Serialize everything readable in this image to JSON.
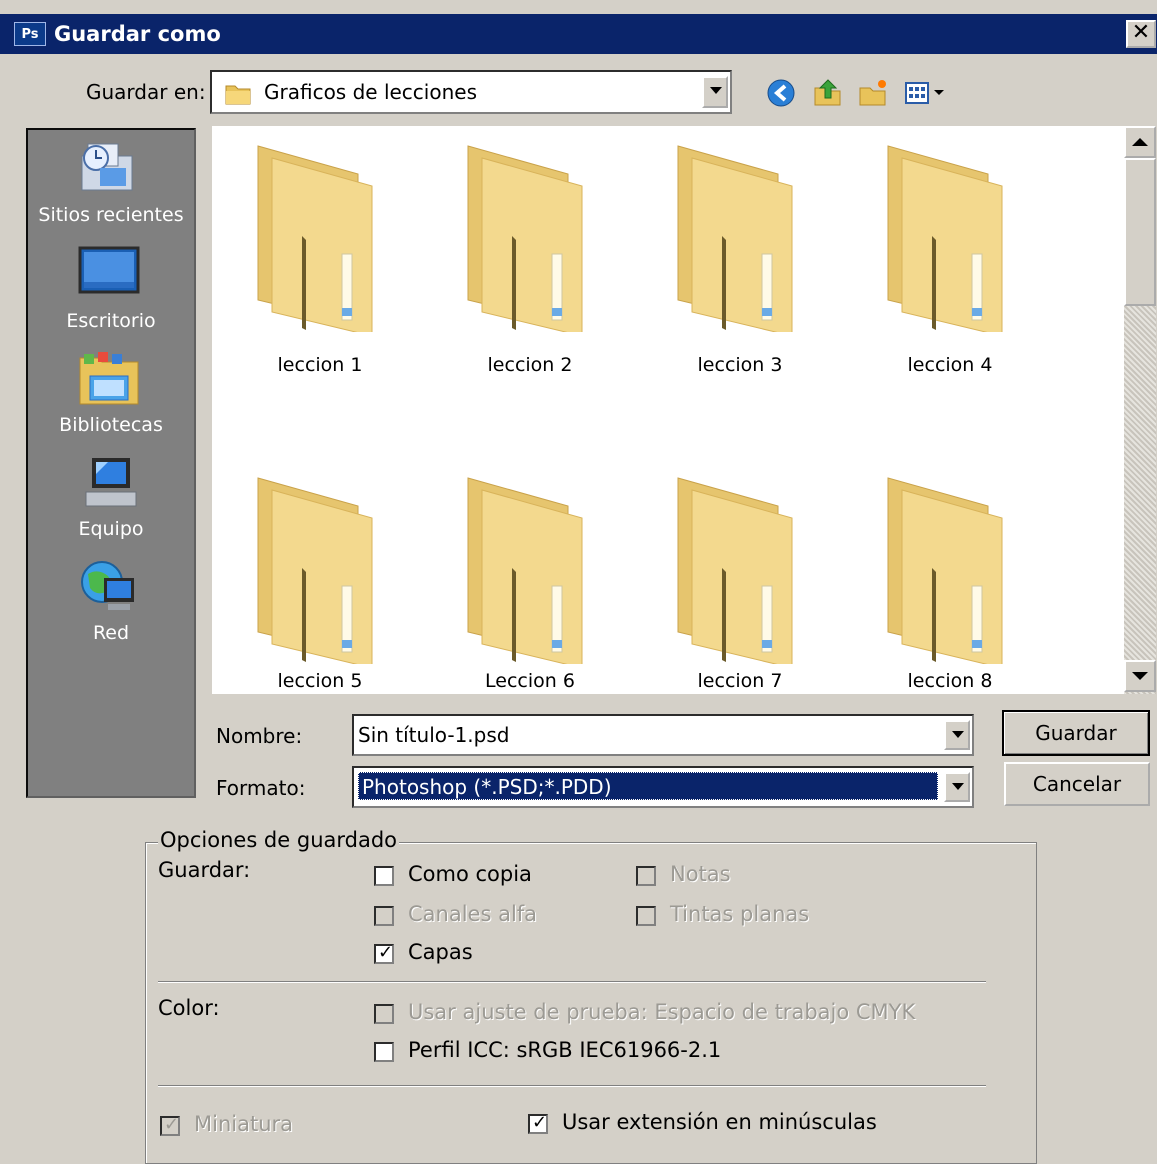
{
  "window": {
    "title": "Guardar como",
    "app_icon_text": "Ps",
    "close_label": "✕"
  },
  "look_in": {
    "label": "Guardar en:",
    "value": "Graficos de lecciones"
  },
  "places": [
    {
      "label": "Sitios recientes",
      "icon": "recent-places-icon"
    },
    {
      "label": "Escritorio",
      "icon": "desktop-icon"
    },
    {
      "label": "Bibliotecas",
      "icon": "libraries-icon"
    },
    {
      "label": "Equipo",
      "icon": "computer-icon"
    },
    {
      "label": "Red",
      "icon": "network-icon"
    }
  ],
  "folders": [
    {
      "label": "leccion 1"
    },
    {
      "label": "leccion 2"
    },
    {
      "label": "leccion 3"
    },
    {
      "label": "leccion 4"
    },
    {
      "label": "leccion 5"
    },
    {
      "label": "Leccion 6"
    },
    {
      "label": "leccion 7"
    },
    {
      "label": "leccion 8"
    }
  ],
  "filename": {
    "label": "Nombre:",
    "value": "Sin título-1.psd"
  },
  "format": {
    "label": "Formato:",
    "value": "Photoshop (*.PSD;*.PDD)"
  },
  "buttons": {
    "save": "Guardar",
    "cancel": "Cancelar"
  },
  "options": {
    "legend": "Opciones de guardado",
    "save_label": "Guardar:",
    "as_copy": "Como copia",
    "notes": "Notas",
    "alpha_channels": "Canales alfa",
    "spot_colors": "Tintas planas",
    "layers": "Capas",
    "color_label": "Color:",
    "proof_setup": "Usar ajuste de prueba: Espacio de trabajo CMYK",
    "icc_profile": "Perfil ICC: sRGB IEC61966-2.1",
    "thumbnail": "Miniatura",
    "lowercase_ext": "Usar extensión en minúsculas"
  },
  "colors": {
    "titlebar": "#0a246a",
    "selection": "#0a246a",
    "face": "#d4d0c8"
  }
}
